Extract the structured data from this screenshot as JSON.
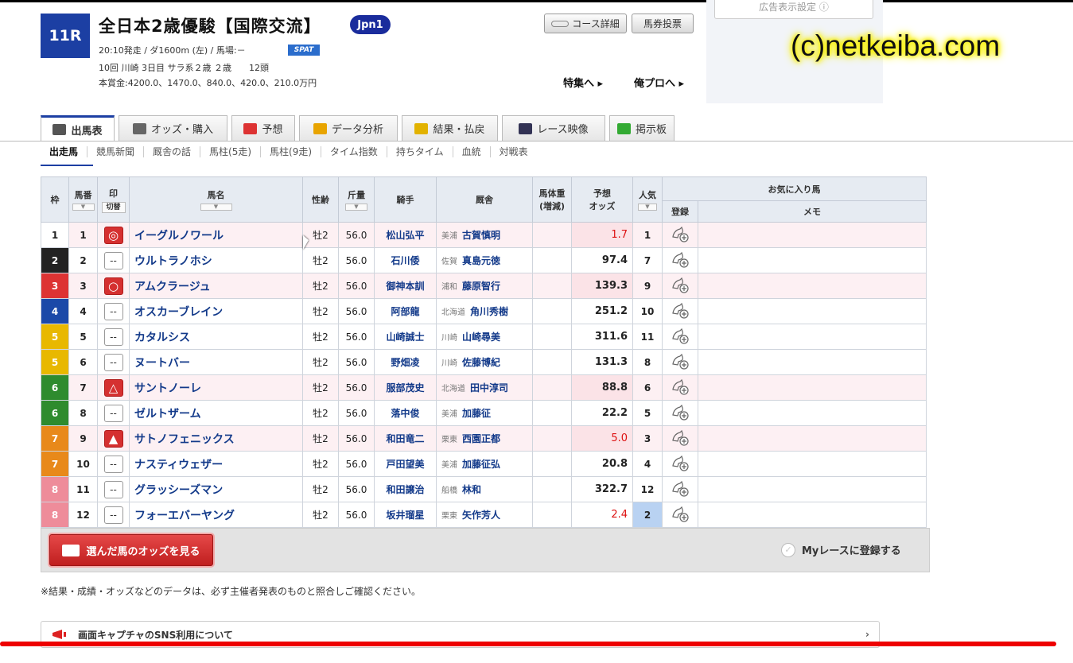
{
  "race": {
    "number": "11R",
    "title": "全日本2歳優駿【国際交流】",
    "grade": "Jpn1",
    "info1": "20:10発走 / ダ1600m (左) / 馬場:－",
    "spat": "SPAT",
    "info2": "10回 川崎 3日目 サラ系２歳 ２歳　　12頭",
    "info3": "本賞金:4200.0、1470.0、840.0、420.0、210.0万円"
  },
  "header_buttons": {
    "course_detail": "コース詳細",
    "ticket": "馬券投票",
    "special_link": "特集へ",
    "blog_link": "俺プロへ",
    "ad_setting": "広告表示設定"
  },
  "watermark": "(c)netkeiba.com",
  "tabs": [
    {
      "label": "出馬表",
      "icon": "table-icon",
      "color": "#555"
    },
    {
      "label": "オッズ・購入",
      "icon": "odds-icon",
      "color": "#666"
    },
    {
      "label": "予想",
      "icon": "target-icon",
      "color": "#d33"
    },
    {
      "label": "データ分析",
      "icon": "bar-chart-icon",
      "color": "#e8a400"
    },
    {
      "label": "結果・払戻",
      "icon": "coins-icon",
      "color": "#e2b200"
    },
    {
      "label": "レース映像",
      "icon": "video-icon",
      "color": "#335"
    },
    {
      "label": "掲示板",
      "icon": "chat-icon",
      "color": "#3a3"
    }
  ],
  "subtabs": [
    "出走馬",
    "競馬新聞",
    "厩舎の話",
    "馬柱(5走)",
    "馬柱(9走)",
    "タイム指数",
    "持ちタイム",
    "血統",
    "対戦表"
  ],
  "table": {
    "headers": {
      "waku": "枠",
      "umaban": "馬番",
      "mark": "印",
      "mark_toggle": "切替",
      "name": "馬名",
      "sex_age": "性齢",
      "weight": "斤量",
      "jockey": "騎手",
      "trainer": "厩舎",
      "body_weight": "馬体重",
      "body_weight_sub": "(増減)",
      "odds": "予想",
      "odds_sub": "オッズ",
      "popularity": "人気",
      "favorite": "お気に入り馬",
      "register": "登録",
      "memo": "メモ"
    },
    "rows": [
      {
        "waku": "1",
        "waku_bg": "#ffffff",
        "waku_fg": "#222222",
        "num": "1",
        "mark": "◎",
        "mark_style": "red",
        "name": "イーグルノワール",
        "sex": "牡2",
        "weight": "56.0",
        "jockey": "松山弘平",
        "region": "美浦",
        "trainer": "古賀慎明",
        "body": "",
        "odds": "1.7",
        "odds_red": true,
        "pop": "1",
        "pop_bg": "pop1",
        "fav": true
      },
      {
        "waku": "2",
        "waku_bg": "#222222",
        "waku_fg": "#ffffff",
        "num": "2",
        "mark": "--",
        "mark_style": "",
        "name": "ウルトラノホシ",
        "sex": "牡2",
        "weight": "56.0",
        "jockey": "石川倭",
        "region": "佐賀",
        "trainer": "真島元徳",
        "body": "",
        "odds": "97.4",
        "odds_red": false,
        "pop": "7",
        "pop_bg": "",
        "fav": false
      },
      {
        "waku": "3",
        "waku_bg": "#dd3333",
        "waku_fg": "#ffffff",
        "num": "3",
        "mark": "○",
        "mark_style": "red",
        "name": "アムクラージュ",
        "sex": "牡2",
        "weight": "56.0",
        "jockey": "御神本訓",
        "region": "浦和",
        "trainer": "藤原智行",
        "body": "",
        "odds": "139.3",
        "odds_red": false,
        "pop": "9",
        "pop_bg": "",
        "fav": true
      },
      {
        "waku": "4",
        "waku_bg": "#1b49a8",
        "waku_fg": "#ffffff",
        "num": "4",
        "mark": "--",
        "mark_style": "",
        "name": "オスカーブレイン",
        "sex": "牡2",
        "weight": "56.0",
        "jockey": "阿部龍",
        "region": "北海道",
        "trainer": "角川秀樹",
        "body": "",
        "odds": "251.2",
        "odds_red": false,
        "pop": "10",
        "pop_bg": "",
        "fav": false
      },
      {
        "waku": "5",
        "waku_bg": "#e8b800",
        "waku_fg": "#ffffff",
        "num": "5",
        "mark": "--",
        "mark_style": "",
        "name": "カタルシス",
        "sex": "牡2",
        "weight": "56.0",
        "jockey": "山崎誠士",
        "region": "川崎",
        "trainer": "山崎尋美",
        "body": "",
        "odds": "311.6",
        "odds_red": false,
        "pop": "11",
        "pop_bg": "",
        "fav": false
      },
      {
        "waku": "5",
        "waku_bg": "#e8b800",
        "waku_fg": "#ffffff",
        "num": "6",
        "mark": "--",
        "mark_style": "",
        "name": "ヌートバー",
        "sex": "牡2",
        "weight": "56.0",
        "jockey": "野畑凌",
        "region": "川崎",
        "trainer": "佐藤博紀",
        "body": "",
        "odds": "131.3",
        "odds_red": false,
        "pop": "8",
        "pop_bg": "",
        "fav": false
      },
      {
        "waku": "6",
        "waku_bg": "#2e8b2e",
        "waku_fg": "#ffffff",
        "num": "7",
        "mark": "△",
        "mark_style": "red",
        "name": "サントノーレ",
        "sex": "牡2",
        "weight": "56.0",
        "jockey": "服部茂史",
        "region": "北海道",
        "trainer": "田中淳司",
        "body": "",
        "odds": "88.8",
        "odds_red": false,
        "pop": "6",
        "pop_bg": "",
        "fav": true
      },
      {
        "waku": "6",
        "waku_bg": "#2e8b2e",
        "waku_fg": "#ffffff",
        "num": "8",
        "mark": "--",
        "mark_style": "",
        "name": "ゼルトザーム",
        "sex": "牡2",
        "weight": "56.0",
        "jockey": "落中俊",
        "region": "美浦",
        "trainer": "加藤征",
        "body": "",
        "odds": "22.2",
        "odds_red": false,
        "pop": "5",
        "pop_bg": "",
        "fav": false
      },
      {
        "waku": "7",
        "waku_bg": "#e8891a",
        "waku_fg": "#ffffff",
        "num": "9",
        "mark": "▲",
        "mark_style": "red",
        "name": "サトノフェニックス",
        "sex": "牡2",
        "weight": "56.0",
        "jockey": "和田竜二",
        "region": "栗東",
        "trainer": "西園正都",
        "body": "",
        "odds": "5.0",
        "odds_red": true,
        "pop": "3",
        "pop_bg": "pop3",
        "fav": true
      },
      {
        "waku": "7",
        "waku_bg": "#e8891a",
        "waku_fg": "#ffffff",
        "num": "10",
        "mark": "--",
        "mark_style": "",
        "name": "ナスティウェザー",
        "sex": "牡2",
        "weight": "56.0",
        "jockey": "戸田望美",
        "region": "美浦",
        "trainer": "加藤征弘",
        "body": "",
        "odds": "20.8",
        "odds_red": false,
        "pop": "4",
        "pop_bg": "",
        "fav": false
      },
      {
        "waku": "8",
        "waku_bg": "#ee8c9a",
        "waku_fg": "#ffffff",
        "num": "11",
        "mark": "--",
        "mark_style": "",
        "name": "グラッシーズマン",
        "sex": "牡2",
        "weight": "56.0",
        "jockey": "和田譲治",
        "region": "船橋",
        "trainer": "林和",
        "body": "",
        "odds": "322.7",
        "odds_red": false,
        "pop": "12",
        "pop_bg": "",
        "fav": false
      },
      {
        "waku": "8",
        "waku_bg": "#ee8c9a",
        "waku_fg": "#ffffff",
        "num": "12",
        "mark": "--",
        "mark_style": "",
        "name": "フォーエバーヤング",
        "sex": "牡2",
        "weight": "56.0",
        "jockey": "坂井瑠星",
        "region": "栗東",
        "trainer": "矢作芳人",
        "body": "",
        "odds": "2.4",
        "odds_red": true,
        "pop": "2",
        "pop_bg": "pop2",
        "fav": false
      }
    ]
  },
  "footer": {
    "odds_button": "選んだ馬のオッズを見る",
    "my_race": "Myレースに登録する",
    "note": "※結果・成績・オッズなどのデータは、必ず主催者発表のものと照合しご確認ください。",
    "sns": "画面キャプチャのSNS利用について"
  }
}
